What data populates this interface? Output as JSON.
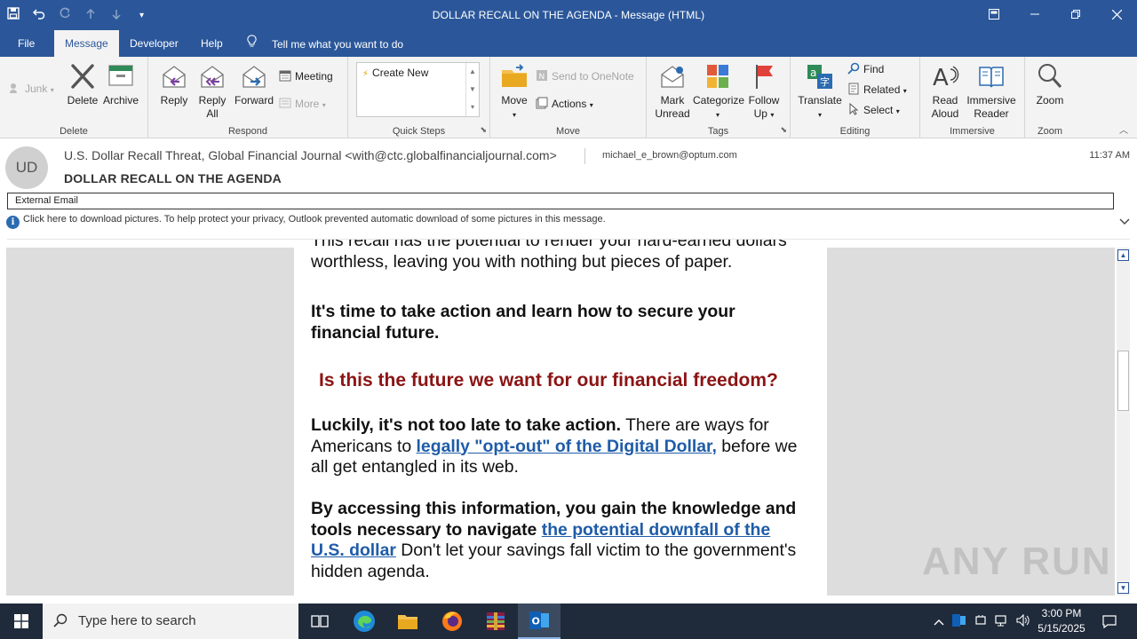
{
  "window": {
    "title": "DOLLAR RECALL ON THE AGENDA  -  Message (HTML)"
  },
  "tabs": [
    "File",
    "Message",
    "Developer",
    "Help"
  ],
  "tell_me": "Tell me what you want to do",
  "ribbon": {
    "delete_group": {
      "label": "Delete",
      "junk": "Junk",
      "delete": "Delete",
      "archive": "Archive"
    },
    "respond_group": {
      "label": "Respond",
      "reply": "Reply",
      "reply_all_1": "Reply",
      "reply_all_2": "All",
      "forward": "Forward",
      "meeting": "Meeting",
      "more": "More"
    },
    "quicksteps_group": {
      "label": "Quick Steps",
      "create_new": "Create New"
    },
    "move_group": {
      "label": "Move",
      "move": "Move",
      "onenote": "Send to OneNote",
      "actions": "Actions"
    },
    "tags_group": {
      "label": "Tags",
      "mark_unread_1": "Mark",
      "mark_unread_2": "Unread",
      "categorize": "Categorize",
      "follow_up_1": "Follow",
      "follow_up_2": "Up"
    },
    "editing_group": {
      "label": "Editing",
      "translate": "Translate",
      "find": "Find",
      "related": "Related",
      "select": "Select"
    },
    "immersive_group": {
      "label": "Immersive",
      "read_aloud_1": "Read",
      "read_aloud_2": "Aloud",
      "immersive_reader_1": "Immersive",
      "immersive_reader_2": "Reader"
    },
    "zoom_group": {
      "label": "Zoom",
      "zoom": "Zoom"
    }
  },
  "message": {
    "avatar_initials": "UD",
    "sender": "U.S. Dollar Recall Threat, Global Financial Journal <with@ctc.globalfinancialjournal.com>",
    "recipient": "michael_e_brown@optum.com",
    "time": "11:37 AM",
    "subject": "DOLLAR RECALL ON THE AGENDA",
    "external_tag": "External Email",
    "info_bar": "Click here to download pictures. To help protect your privacy, Outlook prevented automatic download of some pictures in this message."
  },
  "body": {
    "p1": "This recall has the potential to render your hard-earned dollars worthless, leaving you with nothing but pieces of paper.",
    "p2": "It's time to take action and learn how to secure your financial future.",
    "p3": "Is this the future we want for our financial freedom?",
    "p4_bold": "Luckily, it's not too late to take action.",
    "p4_a": " There are ways for Americans to ",
    "p4_link": "legally \"opt-out\" of the Digital Dollar,",
    "p4_b": " before we all get entangled in its web.",
    "p5_bold": "By accessing this information, you gain the knowledge and tools necessary to navigate ",
    "p5_link": "the potential downfall of the U.S. dollar",
    "p5_b": " Don't let your savings fall victim to the government's hidden agenda."
  },
  "watermark": "ANY RUN",
  "taskbar": {
    "search_placeholder": "Type here to search",
    "time": "3:00 PM",
    "date": "5/15/2025"
  }
}
